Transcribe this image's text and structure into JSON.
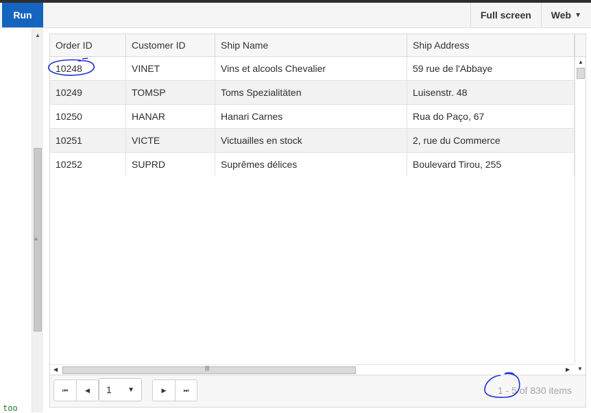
{
  "toolbar": {
    "run_label": "Run",
    "fullscreen_label": "Full screen",
    "web_label": "Web",
    "web_caret": "▼"
  },
  "editor": {
    "visible_text": "too"
  },
  "grid": {
    "columns": [
      "Order ID",
      "Customer ID",
      "Ship Name",
      "Ship Address"
    ],
    "rows": [
      [
        "10248",
        "VINET",
        "Vins et alcools Chevalier",
        "59 rue de l'Abbaye"
      ],
      [
        "10249",
        "TOMSP",
        "Toms Spezialitäten",
        "Luisenstr. 48"
      ],
      [
        "10250",
        "HANAR",
        "Hanari Carnes",
        "Rua do Paço, 67"
      ],
      [
        "10251",
        "VICTE",
        "Victuailles en stock",
        "2, rue du Commerce"
      ],
      [
        "10252",
        "SUPRD",
        "Suprêmes délices",
        "Boulevard Tirou, 255"
      ]
    ]
  },
  "pager": {
    "first_icon": "⏮",
    "prev_icon": "◀",
    "next_icon": "▶",
    "last_icon": "⏭",
    "page_value": "1",
    "page_caret": "▼",
    "info": "1 - 5 of 830 items"
  },
  "colors": {
    "accent": "#1565c0",
    "annotation": "#1a2fd8"
  }
}
